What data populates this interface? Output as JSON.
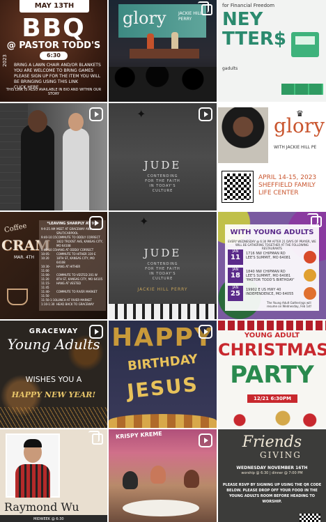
{
  "tiles": {
    "bbq": {
      "date": "MAY 13TH",
      "title": "BBQ",
      "subtitle": "@ PASTOR TODD'S",
      "time": "6:30",
      "year": "2023",
      "bullets": [
        "BRING A LAWN CHAIR AND/OR BLANKETS",
        "YOU ARE WELCOME TO BRING GAMES",
        "PLEASE SIGN UP FOR THE ITEM YOU WILL BE BRINGING USING THIS LINK",
        "CLICK HERE"
      ],
      "footer": "THIS LINK IS ALSO AVAILABLE IN BIO AND WITHIN OUR STORY"
    },
    "glory_stage": {
      "screen_title": "glory",
      "screen_name": "JACKIE HILL PERRY"
    },
    "money": {
      "subtitle": "for Financial Freedom",
      "title_line1": "NEY",
      "title_line2": "TTER$",
      "handle": "gadults"
    },
    "jude1": {
      "title": "JUDE",
      "subtitle": "CONTENDING FOR THE FAITH IN TODAY'S CULTURE"
    },
    "glory_event": {
      "title": "glory",
      "with": "WITH JACKIE HILL PE",
      "date_line1": "APRIL 14-15, 2023",
      "date_line2": "SHEFFIELD FAMILY",
      "date_line3": "LIFE CENTER"
    },
    "cram": {
      "script": "Coffee",
      "title": "CRAM",
      "date": "MAR. 4TH",
      "header": "*LEAVING SHARPLY AT 9:3",
      "schedule": [
        {
          "time": "9-9:25 AM",
          "text": "MEET AT GRACEWAY AND SPLIT/CARPOOL"
        },
        {
          "time": "9:40-10:15",
          "text": "COMMUTE TO ODDLY CORRECT 1822 TROOST AVE, KANSAS CITY, MO 64108"
        },
        {
          "time": "9:40-10:15",
          "text": "HANG AT ODDLY CORRECT"
        },
        {
          "time": "10:05-10:20",
          "text": "COMMUTE TO HITHER 319 E 18TH ST, KANSAS CITY, MO 64108"
        },
        {
          "time": "10:30-11:00",
          "text": "HANG AT HITHER"
        },
        {
          "time": "11:00-11:20",
          "text": "COMMUTE TO VESTED 201 W 8TH ST, KANSAS CITY, MO 64105"
        },
        {
          "time": "11:15-11:45",
          "text": "HANG AT VESTED"
        },
        {
          "time": "11:40-11:50",
          "text": "COMMUTE TO RIVER MARKET"
        },
        {
          "time": "11:50-1:10",
          "text": "LUNCH AT RIVER MARKET"
        },
        {
          "time": "1:10-1:30",
          "text": "HEAD BACK TO GRACEWAY"
        }
      ]
    },
    "jude2": {
      "title": "JUDE",
      "subtitle": "CONTENDING FOR THE FAITH IN TODAY'S CULTURE",
      "author": "JACKIE HILL PERRY"
    },
    "prayer": {
      "title": "WITH YOUNG ADULTS",
      "intro": "EVERY WEDNESDAY @ 6:30 PM AFTER 21 DAYS OF PRAYER, WE WILL BE GATHERING TOGETHER AT THE FOLLOWING RESTAURANTS",
      "events": [
        {
          "month": "JAN",
          "day": "11",
          "addr1": "1716 NW CHIPMAN RD",
          "addr2": "LEE'S SUMMIT, MO 64081"
        },
        {
          "month": "JAN",
          "day": "18",
          "addr1": "1840 NW CHIPMAN RD",
          "addr2": "LEE'S SUMMIT, MO 64081",
          "addr3": "'PASTOR TODD'S BIRTHDAY'"
        },
        {
          "month": "JAN",
          "day": "25",
          "addr1": "19902 E US HWY 40",
          "addr2": "INDEPENDENCE, MO 64055"
        }
      ],
      "note": "The Young Adult Gatherings will resume on Wednesday, Feb 1st!"
    },
    "newyear": {
      "brand": "GRACEWAY",
      "title": "Young Adults",
      "wishes": "WISHES YOU A",
      "hny": "HAPPY NEW YEAR!"
    },
    "birthday": {
      "happy": "HAPPY",
      "birthday": "BIRTHDAY",
      "jesus": "JESUS"
    },
    "christmas": {
      "ya": "YOUNG ADULT",
      "christmas": "CHRISTMAS",
      "party": "PARTY",
      "date": "12/21 6:30PM"
    },
    "raymond": {
      "name": "Raymond Wu",
      "bar": "MIDWEEK @ 6:30"
    },
    "restaurant": {
      "sign": "KRISPY KREME"
    },
    "friendsgiving": {
      "friends": "Friends",
      "giving": "GIVING",
      "when": "WEDNESDAY   NOVEMBER 16TH",
      "times": "worship @ 6:30  |  dinner @ 7:00 PM",
      "desc": "PLEASE RSVP BY SIGNING UP USING THE QR CODE BELOW. PLEASE DROP OFF YOUR FOOD IN THE YOUNG ADULTS ROOM BEFORE HEADING TO WORSHIP."
    }
  }
}
